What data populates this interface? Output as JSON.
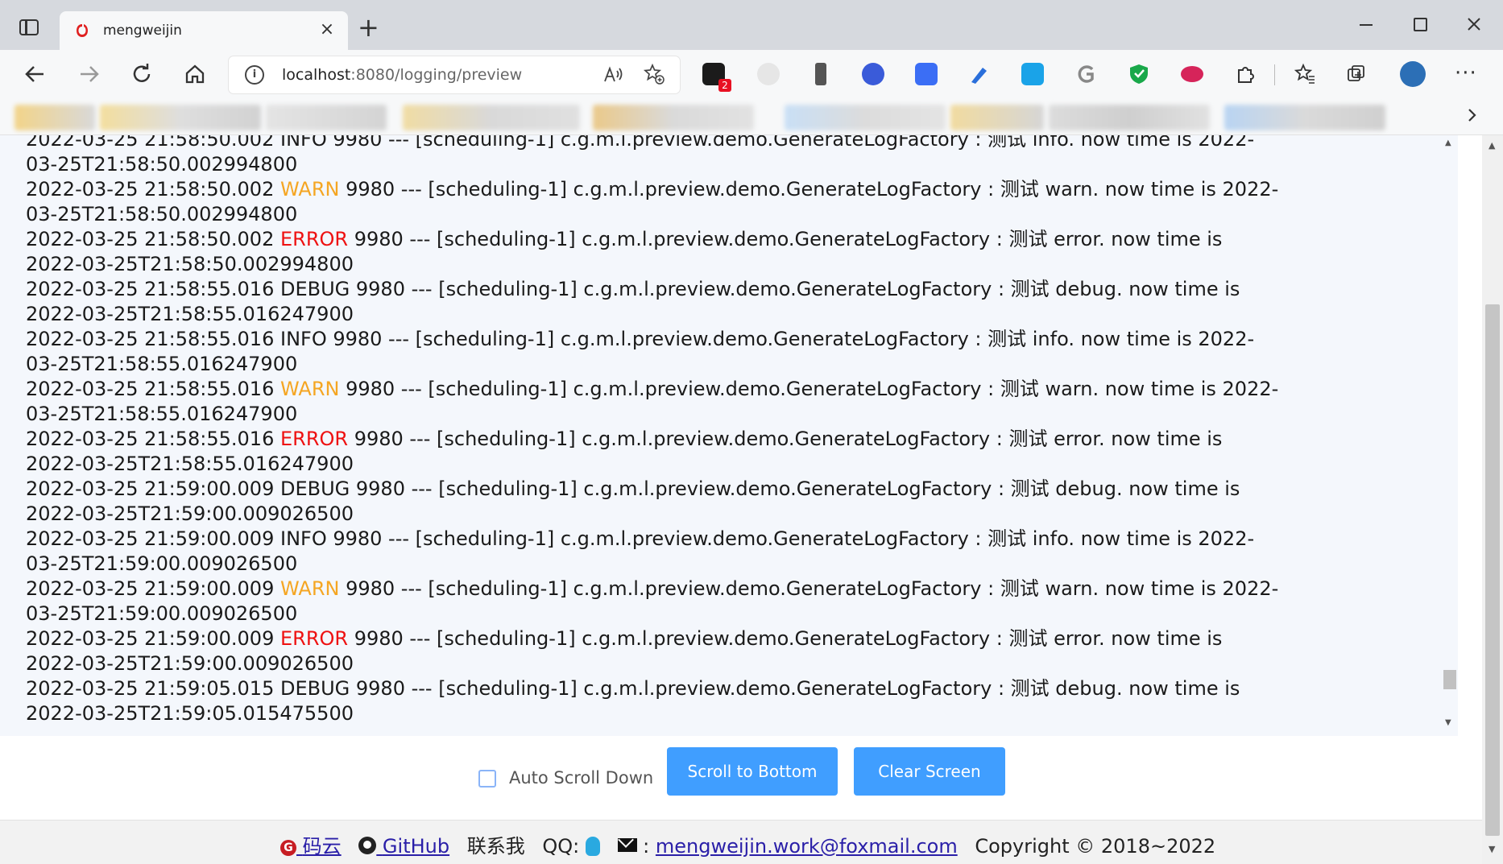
{
  "browser": {
    "tab_title": "mengweijin",
    "tab_close": "×",
    "new_tab": "+",
    "url_host": "localhost",
    "url_rest": ":8080/logging/preview",
    "read_aloud": "A̅",
    "ext_badge": "2"
  },
  "log": {
    "lines": [
      {
        "ts": "2022-03-25 21:58:50.002",
        "level": "INFO",
        "rest": " 9980 --- [scheduling-1] c.g.m.l.preview.demo.GenerateLogFactory : 测试 info. now time is 2022-03-25T21:58:50.002994800"
      },
      {
        "ts": "2022-03-25 21:58:50.002",
        "level": "WARN",
        "rest": " 9980 --- [scheduling-1] c.g.m.l.preview.demo.GenerateLogFactory : 测试 warn. now time is 2022-03-25T21:58:50.002994800"
      },
      {
        "ts": "2022-03-25 21:58:50.002",
        "level": "ERROR",
        "rest": " 9980 --- [scheduling-1] c.g.m.l.preview.demo.GenerateLogFactory : 测试 error. now time is 2022-03-25T21:58:50.002994800"
      },
      {
        "ts": "2022-03-25 21:58:55.016",
        "level": "DEBUG",
        "rest": " 9980 --- [scheduling-1] c.g.m.l.preview.demo.GenerateLogFactory : 测试 debug. now time is 2022-03-25T21:58:55.016247900"
      },
      {
        "ts": "2022-03-25 21:58:55.016",
        "level": "INFO",
        "rest": " 9980 --- [scheduling-1] c.g.m.l.preview.demo.GenerateLogFactory : 测试 info. now time is 2022-03-25T21:58:55.016247900"
      },
      {
        "ts": "2022-03-25 21:58:55.016",
        "level": "WARN",
        "rest": " 9980 --- [scheduling-1] c.g.m.l.preview.demo.GenerateLogFactory : 测试 warn. now time is 2022-03-25T21:58:55.016247900"
      },
      {
        "ts": "2022-03-25 21:58:55.016",
        "level": "ERROR",
        "rest": " 9980 --- [scheduling-1] c.g.m.l.preview.demo.GenerateLogFactory : 测试 error. now time is 2022-03-25T21:58:55.016247900"
      },
      {
        "ts": "2022-03-25 21:59:00.009",
        "level": "DEBUG",
        "rest": " 9980 --- [scheduling-1] c.g.m.l.preview.demo.GenerateLogFactory : 测试 debug. now time is 2022-03-25T21:59:00.009026500"
      },
      {
        "ts": "2022-03-25 21:59:00.009",
        "level": "INFO",
        "rest": " 9980 --- [scheduling-1] c.g.m.l.preview.demo.GenerateLogFactory : 测试 info. now time is 2022-03-25T21:59:00.009026500"
      },
      {
        "ts": "2022-03-25 21:59:00.009",
        "level": "WARN",
        "rest": " 9980 --- [scheduling-1] c.g.m.l.preview.demo.GenerateLogFactory : 测试 warn. now time is 2022-03-25T21:59:00.009026500"
      },
      {
        "ts": "2022-03-25 21:59:00.009",
        "level": "ERROR",
        "rest": " 9980 --- [scheduling-1] c.g.m.l.preview.demo.GenerateLogFactory : 测试 error. now time is 2022-03-25T21:59:00.009026500"
      },
      {
        "ts": "2022-03-25 21:59:05.015",
        "level": "DEBUG",
        "rest": " 9980 --- [scheduling-1] c.g.m.l.preview.demo.GenerateLogFactory : 测试 debug. now time is 2022-03-25T21:59:05.015475500"
      }
    ],
    "level_colors": {
      "WARN": "#f5a623",
      "ERROR": "#ee1111"
    }
  },
  "controls": {
    "auto_scroll_label": "Auto Scroll Down",
    "auto_scroll_checked": false,
    "scroll_bottom_label": "Scroll to Bottom",
    "clear_screen_label": "Clear Screen",
    "button_color": "#409eff"
  },
  "footer": {
    "gitee_glyph": "G",
    "gitee_label": "码云",
    "github_label": "GitHub",
    "contact_label": "联系我",
    "qq_label": "QQ:",
    "mail_sep": ":",
    "email": "mengweijin.work@foxmail.com",
    "copyright": "Copyright © 2018~2022"
  }
}
